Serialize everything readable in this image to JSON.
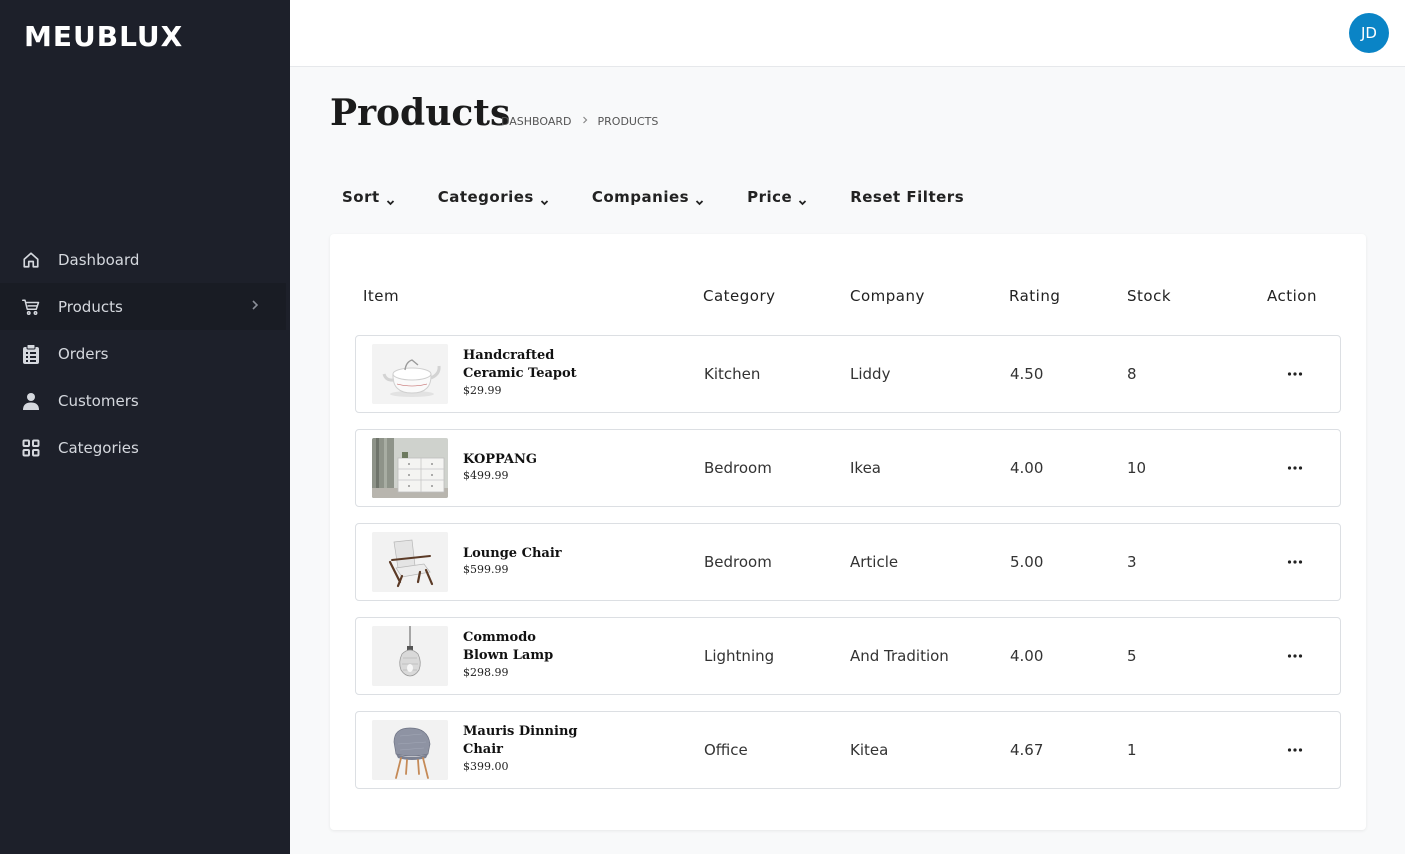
{
  "app": {
    "logo": "MEUBLUX"
  },
  "sidebar": {
    "items": [
      {
        "label": "Dashboard",
        "icon": "home-icon"
      },
      {
        "label": "Products",
        "icon": "cart-icon"
      },
      {
        "label": "Orders",
        "icon": "clipboard-icon"
      },
      {
        "label": "Customers",
        "icon": "user-icon"
      },
      {
        "label": "Categories",
        "icon": "grid-icon"
      }
    ]
  },
  "header": {
    "avatar_initials": "JD"
  },
  "page": {
    "title": "Products",
    "breadcrumb": [
      "DASHBOARD",
      "PRODUCTS"
    ]
  },
  "filters": {
    "sort": "Sort",
    "categories": "Categories",
    "companies": "Companies",
    "price": "Price",
    "reset": "Reset Filters"
  },
  "table": {
    "columns": [
      "Item",
      "Category",
      "Company",
      "Rating",
      "Stock",
      "Action"
    ],
    "rows": [
      {
        "name": "Handcrafted Ceramic Teapot",
        "price": "$29.99",
        "category": "Kitchen",
        "company": "Liddy",
        "rating": "4.50",
        "stock": "8"
      },
      {
        "name": "KOPPANG",
        "price": "$499.99",
        "category": "Bedroom",
        "company": "Ikea",
        "rating": "4.00",
        "stock": "10"
      },
      {
        "name": "Lounge Chair",
        "price": "$599.99",
        "category": "Bedroom",
        "company": "Article",
        "rating": "5.00",
        "stock": "3"
      },
      {
        "name": "Commodo Blown Lamp",
        "price": "$298.99",
        "category": "Lightning",
        "company": "And Tradition",
        "rating": "4.00",
        "stock": "5"
      },
      {
        "name": "Mauris Dinning Chair",
        "price": "$399.00",
        "category": "Office",
        "company": "Kitea",
        "rating": "4.67",
        "stock": "1"
      }
    ]
  },
  "colors": {
    "sidebar_bg": "#1d202a",
    "avatar_bg": "#0a84c6",
    "page_bg": "#f8f9fa"
  }
}
